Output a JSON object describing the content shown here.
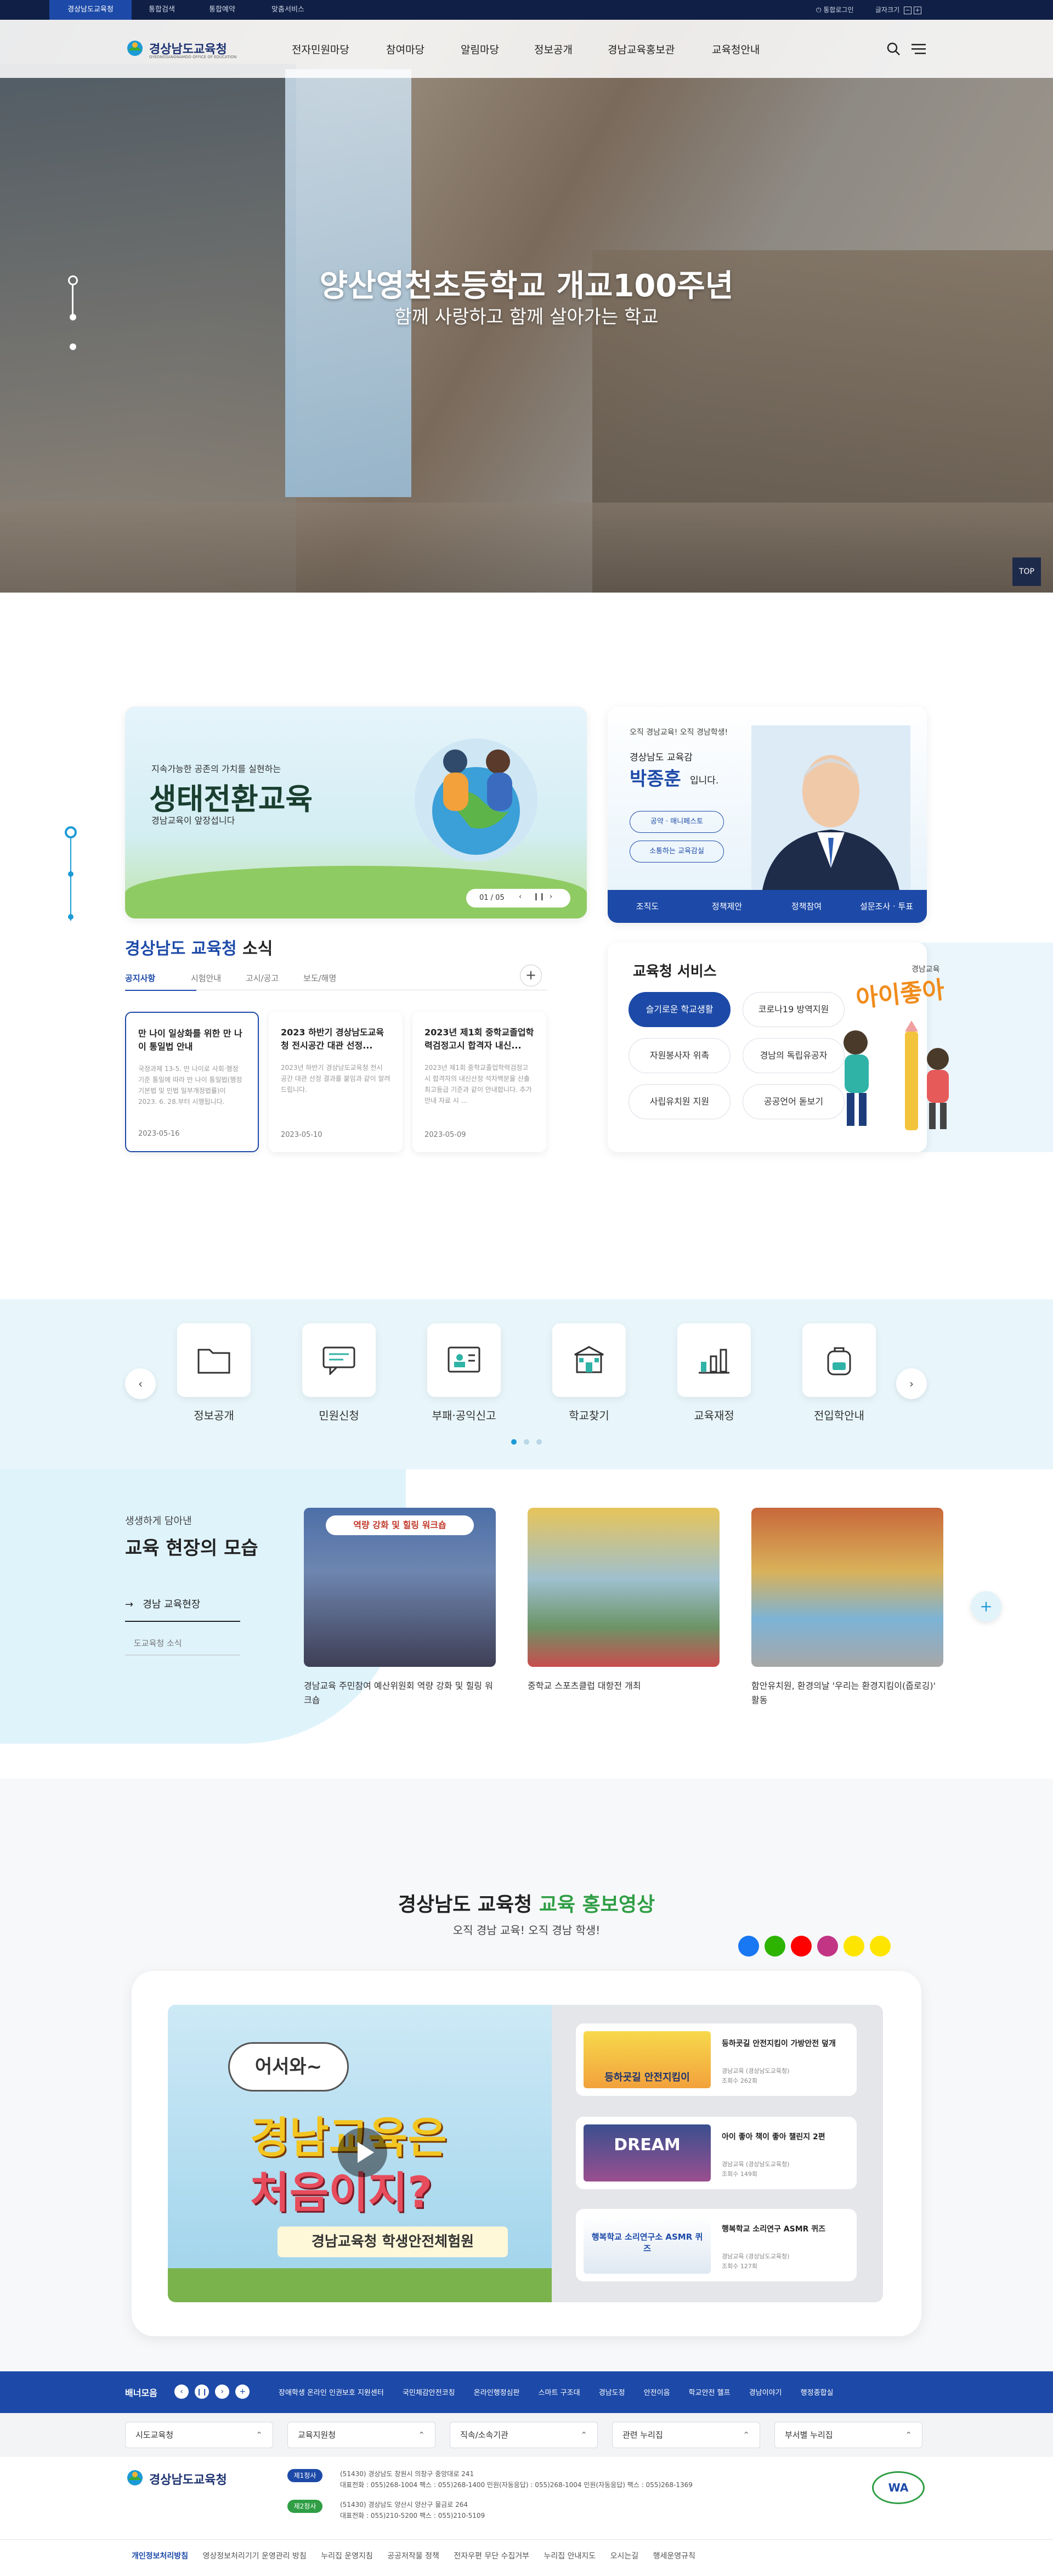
{
  "util": {
    "tabs": [
      "경상남도교육청",
      "통합검색",
      "통합예약",
      "맞춤서비스"
    ],
    "login": "통합로그인",
    "zoom": "글자크기"
  },
  "header": {
    "logo": "경상남도교육청",
    "logo_sub": "GYEONGSANGNAMDO OFFICE OF EDUCATION",
    "menu": [
      "전자민원마당",
      "참여마당",
      "알림마당",
      "정보공개",
      "경남교육홍보관",
      "교육청안내"
    ]
  },
  "hero": {
    "title": "양산영천초등학교 개교100주년",
    "subtitle": "함께 사랑하고 함께 살아가는 학교",
    "top": "TOP"
  },
  "banner": {
    "small": "지속가능한 공존의 가치를 실현하는",
    "title": "생태전환교육",
    "sub": "경남교육이 앞장섭니다",
    "page": "01 / 05"
  },
  "superintendent": {
    "greeting": "오직 경남교육! 오직 경남학생!",
    "role": "경상남도 교육감",
    "name": "박종훈",
    "suffix": "입니다.",
    "btn1": "공약 · 매니페스토",
    "btn2": "소통하는 교육감실",
    "tabs": [
      "조직도",
      "정책제안",
      "정책참여",
      "설문조사 · 투표"
    ]
  },
  "news": {
    "title_a": "경상남도 교육청",
    "title_b": " 소식",
    "tabs": [
      "공지사항",
      "시험안내",
      "고시/공고",
      "보도/해명"
    ],
    "items": [
      {
        "title": "만 나이 일상화를 위한 만 나이 통일법 안내",
        "desc": "국정과제 13-5. 만 나이로 사회·행정 기준 통일에 따라 만 나이 통일법(행정기본법 및 민법 일부개정법률)이 2023. 6. 28.부터 시행됩니다.",
        "date": "2023-05-16"
      },
      {
        "title": "2023 하반기 경상남도교육청 전시공간 대관 선정...",
        "desc": "2023년 하반기 경상남도교육청 전시 공간 대관 선정 결과를 붙임과 같이 알려드립니다.",
        "date": "2023-05-10"
      },
      {
        "title": "2023년 제1회 중학교졸업학력검정고시 합격자 내신...",
        "desc": "2023년 제1회 중학교졸업학력검정고시 합격자의 내신산정 석차백분율 산출 최고등급 기준과 같이 안내합니다. 추가 안내 자료 시 ...",
        "date": "2023-05-09"
      }
    ]
  },
  "services": {
    "title": "교육청 서비스",
    "brand_small": "경남교육",
    "brand": "아이좋아",
    "buttons": [
      "슬기로운 학교생활",
      "코로나19 방역지원",
      "자원봉사자 위촉",
      "경남의 독립유공자",
      "사립유치원 지원",
      "공공언어 돋보기"
    ]
  },
  "quick": {
    "items": [
      "정보공개",
      "민원신청",
      "부패·공익신고",
      "학교찾기",
      "교육재정",
      "전입학안내"
    ]
  },
  "field": {
    "small": "생생하게 담아낸",
    "title": "교육 현장의 모습",
    "link1": "경남 교육현장",
    "link2": "도교육청 소식",
    "photos": [
      {
        "banner": "역량 강화 및 힐링 워크숍",
        "caption": "경남교육 주민참여 예산위원회 역량 강화 및 힐링 워크숍"
      },
      {
        "banner": "",
        "caption": "중학교 스포츠클럽 대항전 개최"
      },
      {
        "banner": "",
        "caption": "함안유치원, 환경의날 '우리는 환경지킴이(줍로깅)' 활동"
      }
    ]
  },
  "video": {
    "title_a": "경상남도 교육청",
    "title_b": " 교육 홍보영상",
    "sub": "오직 경남 교육! 오직 경남 학생!",
    "main": {
      "l1": "어서와~",
      "l2": "경남교육은",
      "l3": "처음이지?",
      "l4": "경남교육청 학생안전체험원"
    },
    "list": [
      {
        "title": "등하굣길 안전지킴이 가방안전 덮개",
        "org": "경남교육 (경상남도교육청)",
        "views": "조회수 262회",
        "thumb": "등하굣길 안전지킴이"
      },
      {
        "title": "아이 좋아 책이 좋아 챌린지 2편",
        "org": "경남교육 (경상남도교육청)",
        "views": "조회수 149회",
        "thumb": "DREAM"
      },
      {
        "title": "행복학교 소리연구 ASMR 퀴즈",
        "org": "경남교육 (경상남도교육청)",
        "views": "조회수 127회",
        "thumb": "행복학교 소리연구소 ASMR 퀴즈"
      }
    ]
  },
  "banner_strip": {
    "label": "배너모음",
    "links": [
      "장애학생 온라인 인권보호 지원센터",
      "국민체감안전코칭",
      "온라인행정심판",
      "스마트 구조대",
      "경남도정",
      "안전이음",
      "학교안전 헬프",
      "경남이야기",
      "행정종합실"
    ]
  },
  "footer": {
    "selects": [
      "시도교육청",
      "교육지원청",
      "직속/소속기관",
      "관련 누리집",
      "부서별 누리집"
    ],
    "logo": "경상남도교육청",
    "campus1": "제1청사",
    "addr1": "(51430) 경상남도 창원시 의창구 중앙대로 241",
    "tel1": "대표전화 : 055)268-1004  팩스 : 055)268-1400  민원(자동응답) : 055)268-1004  민원(자동응답) 팩스 : 055)268-1369",
    "campus2": "제2청사",
    "addr2": "(51430) 경상남도 양산시 양산구 물금로 264",
    "tel2": "대표전화 : 055)210-5200  팩스 : 055)210-5109",
    "bottom_links": [
      "개인정보처리방침",
      "영상정보처리기기 운영관리 방침",
      "누리집 운영지침",
      "공공저작물 정책",
      "전자우편 무단 수집거부",
      "누리집 안내지도",
      "오시는길",
      "행세운영규칙"
    ],
    "wa": "WA"
  }
}
